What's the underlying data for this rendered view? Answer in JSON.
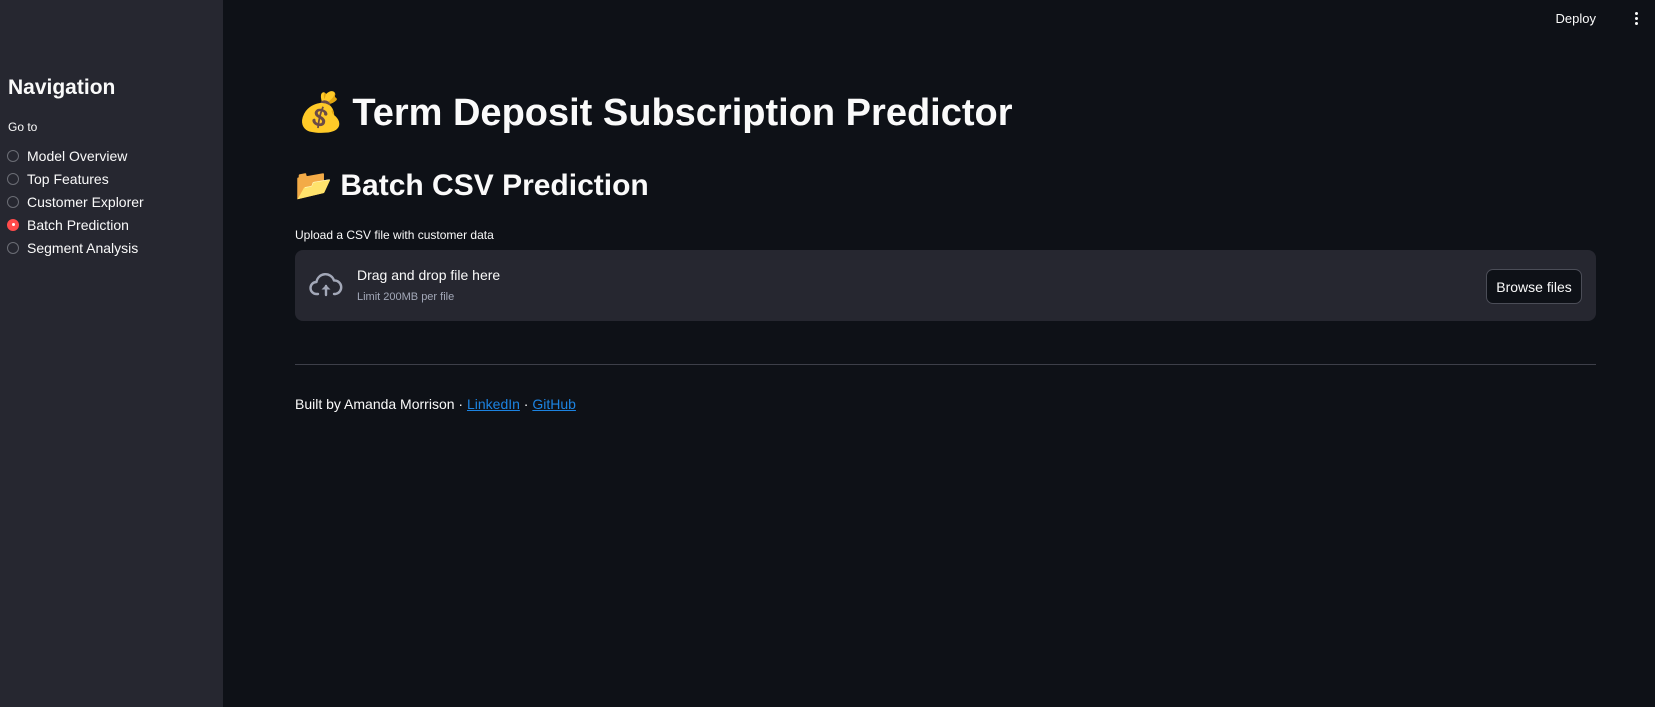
{
  "header": {
    "deploy_label": "Deploy",
    "menu_icon": "vertical-ellipsis-icon"
  },
  "sidebar": {
    "title": "Navigation",
    "goto_label": "Go to",
    "items": [
      {
        "label": "Model Overview",
        "selected": false
      },
      {
        "label": "Top Features",
        "selected": false
      },
      {
        "label": "Customer Explorer",
        "selected": false
      },
      {
        "label": "Batch Prediction",
        "selected": true
      },
      {
        "label": "Segment Analysis",
        "selected": false
      }
    ],
    "selected_color": "#ff4b4b"
  },
  "main": {
    "title_emoji": "💰",
    "title": "Term Deposit Subscription Predictor",
    "section_emoji": "📂",
    "section_title": "Batch CSV Prediction",
    "upload": {
      "label": "Upload a CSV file with customer data",
      "drop_text": "Drag and drop file here",
      "limit_text": "Limit 200MB per file",
      "browse_label": "Browse files",
      "icon": "cloud-upload-icon"
    },
    "footer": {
      "prefix": "Built by Amanda Morrison · ",
      "linkedin": "LinkedIn",
      "separator": " · ",
      "github": "GitHub"
    }
  },
  "colors": {
    "background": "#0e1117",
    "sidebar": "#262730",
    "link": "#1c83e1",
    "accent": "#ff4b4b"
  }
}
